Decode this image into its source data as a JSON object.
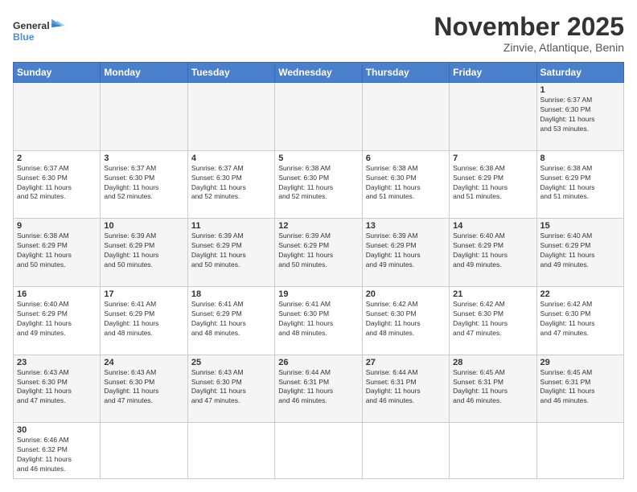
{
  "header": {
    "logo_general": "General",
    "logo_blue": "Blue",
    "month_title": "November 2025",
    "location": "Zinvie, Atlantique, Benin"
  },
  "weekdays": [
    "Sunday",
    "Monday",
    "Tuesday",
    "Wednesday",
    "Thursday",
    "Friday",
    "Saturday"
  ],
  "weeks": [
    [
      {
        "day": "",
        "info": ""
      },
      {
        "day": "",
        "info": ""
      },
      {
        "day": "",
        "info": ""
      },
      {
        "day": "",
        "info": ""
      },
      {
        "day": "",
        "info": ""
      },
      {
        "day": "",
        "info": ""
      },
      {
        "day": "1",
        "info": "Sunrise: 6:37 AM\nSunset: 6:30 PM\nDaylight: 11 hours\nand 53 minutes."
      }
    ],
    [
      {
        "day": "2",
        "info": "Sunrise: 6:37 AM\nSunset: 6:30 PM\nDaylight: 11 hours\nand 52 minutes."
      },
      {
        "day": "3",
        "info": "Sunrise: 6:37 AM\nSunset: 6:30 PM\nDaylight: 11 hours\nand 52 minutes."
      },
      {
        "day": "4",
        "info": "Sunrise: 6:37 AM\nSunset: 6:30 PM\nDaylight: 11 hours\nand 52 minutes."
      },
      {
        "day": "5",
        "info": "Sunrise: 6:38 AM\nSunset: 6:30 PM\nDaylight: 11 hours\nand 52 minutes."
      },
      {
        "day": "6",
        "info": "Sunrise: 6:38 AM\nSunset: 6:30 PM\nDaylight: 11 hours\nand 51 minutes."
      },
      {
        "day": "7",
        "info": "Sunrise: 6:38 AM\nSunset: 6:29 PM\nDaylight: 11 hours\nand 51 minutes."
      },
      {
        "day": "8",
        "info": "Sunrise: 6:38 AM\nSunset: 6:29 PM\nDaylight: 11 hours\nand 51 minutes."
      }
    ],
    [
      {
        "day": "9",
        "info": "Sunrise: 6:38 AM\nSunset: 6:29 PM\nDaylight: 11 hours\nand 50 minutes."
      },
      {
        "day": "10",
        "info": "Sunrise: 6:39 AM\nSunset: 6:29 PM\nDaylight: 11 hours\nand 50 minutes."
      },
      {
        "day": "11",
        "info": "Sunrise: 6:39 AM\nSunset: 6:29 PM\nDaylight: 11 hours\nand 50 minutes."
      },
      {
        "day": "12",
        "info": "Sunrise: 6:39 AM\nSunset: 6:29 PM\nDaylight: 11 hours\nand 50 minutes."
      },
      {
        "day": "13",
        "info": "Sunrise: 6:39 AM\nSunset: 6:29 PM\nDaylight: 11 hours\nand 49 minutes."
      },
      {
        "day": "14",
        "info": "Sunrise: 6:40 AM\nSunset: 6:29 PM\nDaylight: 11 hours\nand 49 minutes."
      },
      {
        "day": "15",
        "info": "Sunrise: 6:40 AM\nSunset: 6:29 PM\nDaylight: 11 hours\nand 49 minutes."
      }
    ],
    [
      {
        "day": "16",
        "info": "Sunrise: 6:40 AM\nSunset: 6:29 PM\nDaylight: 11 hours\nand 49 minutes."
      },
      {
        "day": "17",
        "info": "Sunrise: 6:41 AM\nSunset: 6:29 PM\nDaylight: 11 hours\nand 48 minutes."
      },
      {
        "day": "18",
        "info": "Sunrise: 6:41 AM\nSunset: 6:29 PM\nDaylight: 11 hours\nand 48 minutes."
      },
      {
        "day": "19",
        "info": "Sunrise: 6:41 AM\nSunset: 6:30 PM\nDaylight: 11 hours\nand 48 minutes."
      },
      {
        "day": "20",
        "info": "Sunrise: 6:42 AM\nSunset: 6:30 PM\nDaylight: 11 hours\nand 48 minutes."
      },
      {
        "day": "21",
        "info": "Sunrise: 6:42 AM\nSunset: 6:30 PM\nDaylight: 11 hours\nand 47 minutes."
      },
      {
        "day": "22",
        "info": "Sunrise: 6:42 AM\nSunset: 6:30 PM\nDaylight: 11 hours\nand 47 minutes."
      }
    ],
    [
      {
        "day": "23",
        "info": "Sunrise: 6:43 AM\nSunset: 6:30 PM\nDaylight: 11 hours\nand 47 minutes."
      },
      {
        "day": "24",
        "info": "Sunrise: 6:43 AM\nSunset: 6:30 PM\nDaylight: 11 hours\nand 47 minutes."
      },
      {
        "day": "25",
        "info": "Sunrise: 6:43 AM\nSunset: 6:30 PM\nDaylight: 11 hours\nand 47 minutes."
      },
      {
        "day": "26",
        "info": "Sunrise: 6:44 AM\nSunset: 6:31 PM\nDaylight: 11 hours\nand 46 minutes."
      },
      {
        "day": "27",
        "info": "Sunrise: 6:44 AM\nSunset: 6:31 PM\nDaylight: 11 hours\nand 46 minutes."
      },
      {
        "day": "28",
        "info": "Sunrise: 6:45 AM\nSunset: 6:31 PM\nDaylight: 11 hours\nand 46 minutes."
      },
      {
        "day": "29",
        "info": "Sunrise: 6:45 AM\nSunset: 6:31 PM\nDaylight: 11 hours\nand 46 minutes."
      }
    ],
    [
      {
        "day": "30",
        "info": "Sunrise: 6:46 AM\nSunset: 6:32 PM\nDaylight: 11 hours\nand 46 minutes."
      },
      {
        "day": "",
        "info": ""
      },
      {
        "day": "",
        "info": ""
      },
      {
        "day": "",
        "info": ""
      },
      {
        "day": "",
        "info": ""
      },
      {
        "day": "",
        "info": ""
      },
      {
        "day": "",
        "info": ""
      }
    ]
  ]
}
